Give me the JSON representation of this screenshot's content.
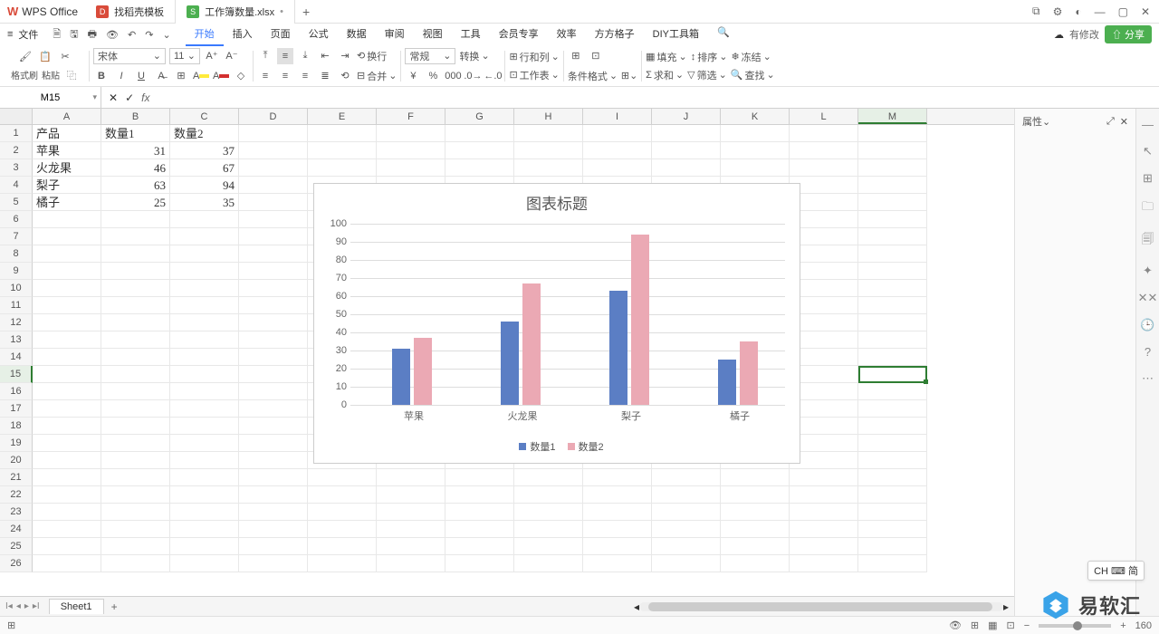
{
  "titlebar": {
    "app_name": "WPS Office",
    "tabs": [
      {
        "icon": "red",
        "label": "找稻壳模板"
      },
      {
        "icon": "green",
        "label": "工作簿数量.xlsx",
        "dirty": "•"
      }
    ],
    "add": "+"
  },
  "menubar": {
    "file": "文件",
    "tabs": [
      "开始",
      "插入",
      "页面",
      "公式",
      "数据",
      "审阅",
      "视图",
      "工具",
      "会员专享",
      "效率",
      "方方格子",
      "DIY工具箱"
    ],
    "active_tab": 0,
    "changes": "有修改",
    "share": "分享"
  },
  "ribbon": {
    "format_painter": "格式刷",
    "paste": "粘贴",
    "font_name": "宋体",
    "font_size": "11",
    "wrap": "换行",
    "merge": "合并",
    "number_format": "常规",
    "convert": "转换",
    "rowcol": "行和列",
    "worksheet": "工作表",
    "cond_format": "条件格式",
    "fill": "填充",
    "sort": "排序",
    "freeze": "冻结",
    "sum": "求和",
    "filter": "筛选",
    "find": "查找"
  },
  "formula_bar": {
    "name_box": "M15",
    "fx": "fx"
  },
  "columns": [
    "A",
    "B",
    "C",
    "D",
    "E",
    "F",
    "G",
    "H",
    "I",
    "J",
    "K",
    "L",
    "M"
  ],
  "active_col_index": 12,
  "active_row_index": 14,
  "row_count": 26,
  "table": {
    "headers": [
      "产品",
      "数量1",
      "数量2"
    ],
    "rows": [
      [
        "苹果",
        "31",
        "37"
      ],
      [
        "火龙果",
        "46",
        "67"
      ],
      [
        "梨子",
        "63",
        "94"
      ],
      [
        "橘子",
        "25",
        "35"
      ]
    ]
  },
  "chart_data": {
    "type": "bar",
    "title": "图表标题",
    "categories": [
      "苹果",
      "火龙果",
      "梨子",
      "橘子"
    ],
    "series": [
      {
        "name": "数量1",
        "values": [
          31,
          46,
          63,
          25
        ],
        "color": "#5b7ec4"
      },
      {
        "name": "数量2",
        "values": [
          37,
          67,
          94,
          35
        ],
        "color": "#eba9b4"
      }
    ],
    "ylim": [
      0,
      100
    ],
    "yticks": [
      0,
      10,
      20,
      30,
      40,
      50,
      60,
      70,
      80,
      90,
      100
    ],
    "xlabel": "",
    "ylabel": ""
  },
  "right_panel": {
    "title": "属性"
  },
  "sheet_tabs": {
    "active": "Sheet1"
  },
  "statusbar": {
    "zoom": "160"
  },
  "ime": "CH ⌨ 简",
  "watermark": "易软汇"
}
